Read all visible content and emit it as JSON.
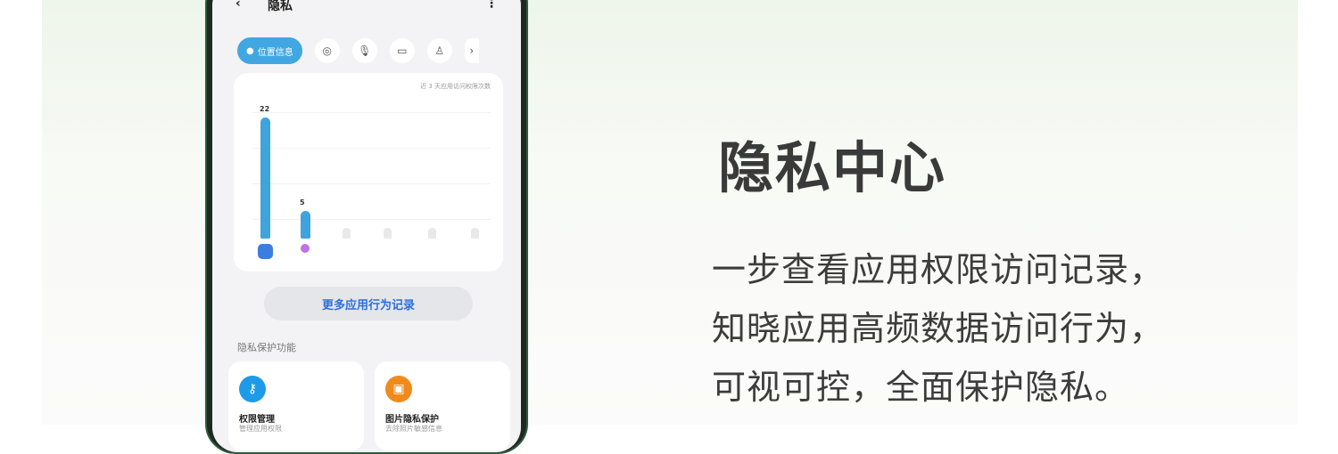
{
  "phone": {
    "title": "隐私",
    "back_icon": "‹",
    "more_icon": "⋮",
    "chips": {
      "active_label": "位置信息",
      "icons": [
        "camera-icon",
        "microphone-icon",
        "folder-icon",
        "contacts-icon",
        "chevron-right-icon"
      ]
    },
    "chart_caption": "近 3 天应用访问权限次数",
    "chart_data": {
      "type": "bar",
      "values": [
        22,
        5,
        0,
        0,
        0,
        0
      ],
      "data_labels": [
        "22",
        "5"
      ],
      "ylim": [
        0,
        24
      ]
    },
    "more_button": "更多应用行为记录",
    "section_title": "隐私保护功能",
    "features": [
      {
        "name": "权限管理",
        "sub": "管理应用权限",
        "color": "#1e9be8"
      },
      {
        "name": "图片隐私保护",
        "sub": "去除照片敏感信息",
        "color": "#f08a1c"
      }
    ],
    "accent": "#40a7e3"
  },
  "promo": {
    "heading": "隐私中心",
    "lines": [
      "一步查看应用权限访问记录，",
      "知晓应用高频数据访问行为，",
      "可视可控，全面保护隐私。"
    ]
  }
}
